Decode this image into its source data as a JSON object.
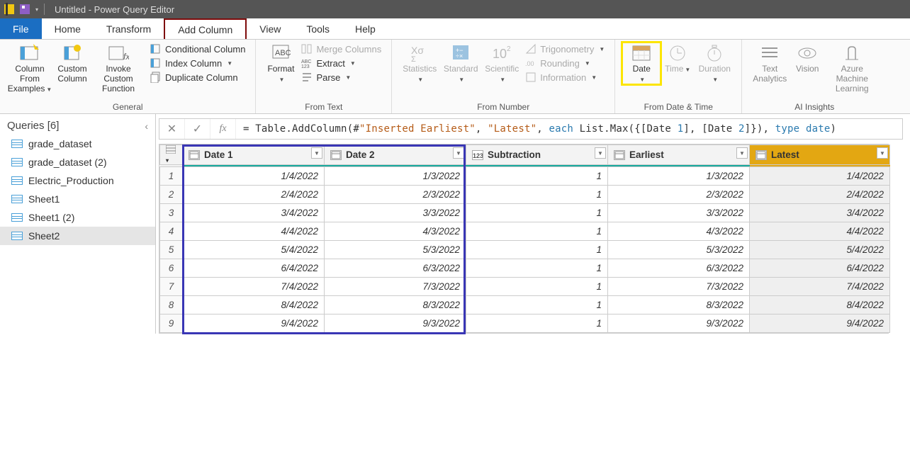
{
  "titlebar": {
    "title": "Untitled - Power Query Editor"
  },
  "tabs": {
    "file": "File",
    "home": "Home",
    "transform": "Transform",
    "addcol": "Add Column",
    "view": "View",
    "tools": "Tools",
    "help": "Help"
  },
  "ribbon": {
    "general": {
      "cfe": "Column From Examples",
      "custom": "Custom Column",
      "invoke": "Invoke Custom Function",
      "cond": "Conditional Column",
      "index": "Index Column",
      "dup": "Duplicate Column",
      "label": "General"
    },
    "fromtext": {
      "format": "Format",
      "merge": "Merge Columns",
      "extract": "Extract",
      "parse": "Parse",
      "label": "From Text"
    },
    "fromnum": {
      "stats": "Statistics",
      "standard": "Standard",
      "sci": "Scientific",
      "trig": "Trigonometry",
      "round": "Rounding",
      "info": "Information",
      "label": "From Number"
    },
    "fromdt": {
      "date": "Date",
      "time": "Time",
      "dur": "Duration",
      "label": "From Date & Time"
    },
    "ai": {
      "ta": "Text Analytics",
      "vis": "Vision",
      "aml": "Azure Machine Learning",
      "label": "AI Insights"
    }
  },
  "queries": {
    "head": "Queries [6]",
    "items": [
      {
        "label": "grade_dataset"
      },
      {
        "label": "grade_dataset (2)"
      },
      {
        "label": "Electric_Production"
      },
      {
        "label": "Sheet1"
      },
      {
        "label": "Sheet1 (2)"
      },
      {
        "label": "Sheet2",
        "selected": true
      }
    ]
  },
  "formula": {
    "prefix": "= Table.AddColumn(#",
    "arg1": "\"Inserted Earliest\"",
    "sep1": ", ",
    "arg2": "\"Latest\"",
    "sep2": ", ",
    "each": "each",
    "body": " List.Max({[Date ",
    "n1": "1",
    "body2": "], [Date ",
    "n2": "2",
    "body3": "]}), ",
    "type": "type date",
    "end": ")"
  },
  "columns": [
    {
      "name": "Date 1",
      "type": "date"
    },
    {
      "name": "Date 2",
      "type": "date"
    },
    {
      "name": "Subtraction",
      "type": "number"
    },
    {
      "name": "Earliest",
      "type": "date"
    },
    {
      "name": "Latest",
      "type": "date",
      "latest": true
    }
  ],
  "rows": [
    {
      "d1": "1/4/2022",
      "d2": "1/3/2022",
      "sub": "1",
      "ear": "1/3/2022",
      "lat": "1/4/2022"
    },
    {
      "d1": "2/4/2022",
      "d2": "2/3/2022",
      "sub": "1",
      "ear": "2/3/2022",
      "lat": "2/4/2022"
    },
    {
      "d1": "3/4/2022",
      "d2": "3/3/2022",
      "sub": "1",
      "ear": "3/3/2022",
      "lat": "3/4/2022"
    },
    {
      "d1": "4/4/2022",
      "d2": "4/3/2022",
      "sub": "1",
      "ear": "4/3/2022",
      "lat": "4/4/2022"
    },
    {
      "d1": "5/4/2022",
      "d2": "5/3/2022",
      "sub": "1",
      "ear": "5/3/2022",
      "lat": "5/4/2022"
    },
    {
      "d1": "6/4/2022",
      "d2": "6/3/2022",
      "sub": "1",
      "ear": "6/3/2022",
      "lat": "6/4/2022"
    },
    {
      "d1": "7/4/2022",
      "d2": "7/3/2022",
      "sub": "1",
      "ear": "7/3/2022",
      "lat": "7/4/2022"
    },
    {
      "d1": "8/4/2022",
      "d2": "8/3/2022",
      "sub": "1",
      "ear": "8/3/2022",
      "lat": "8/4/2022"
    },
    {
      "d1": "9/4/2022",
      "d2": "9/3/2022",
      "sub": "1",
      "ear": "9/3/2022",
      "lat": "9/4/2022"
    }
  ]
}
